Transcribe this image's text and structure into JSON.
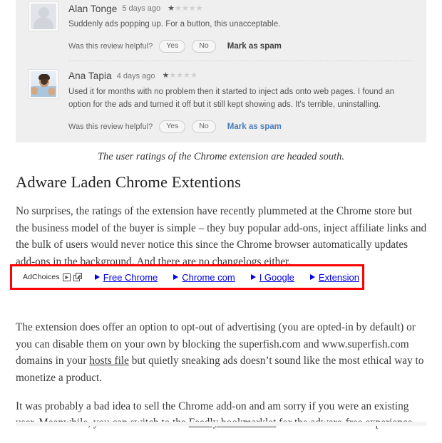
{
  "reviews_panel": {
    "background_color": "#efefef",
    "reviews": [
      {
        "author": "Alan Tonge",
        "age": "5 days ago",
        "rating": 1,
        "rating_max": 5,
        "text": "Suddenly ads popping up. For a button, this unacceptable.",
        "helpful_label": "Was this review helpful?",
        "yes_label": "Yes",
        "no_label": "No",
        "spam_label": "Mark as spam",
        "spam_color": "#3f3f3f",
        "avatar_type": "placeholder-avatar"
      },
      {
        "author": "Ana Tapia",
        "age": "4 days ago",
        "rating": 1,
        "rating_max": 5,
        "text": "Used it for months with no problem then it started to inject ads onto web pages. I found an option for the ads and turned it off but it still kept showing ads. It's terrible, uninstalling.",
        "helpful_label": "Was this review helpful?",
        "yes_label": "Yes",
        "no_label": "No",
        "spam_label": "Mark as spam",
        "spam_color": "#4a7ebb",
        "avatar_type": "user-photo-avatar"
      }
    ]
  },
  "caption": "The user ratings of the Chrome extension are headed south.",
  "article": {
    "heading": "Adware Laden Chrome Extentions",
    "paragraph_1": "No surprises, the ratings of the extension have recently plummeted at the Chrome store but the business model of the buyer is simple – they buy popular add-ons, inject affiliate links and the bulk of users would never notice this since the Chrome browser automatically updates add-ons in the background. And there are no changelogs either.",
    "paragraph_2_a": "The extension does offer an option to opt-out of advertising (you are opted-in by default) or you can disable them on your own by blocking the superfish.com and www.superfish.com domains in your ",
    "paragraph_2_link": "hosts file",
    "paragraph_2_b": " but quietly sneaking ads doesn’t sound like the most ethical way to monetize a product.",
    "paragraph_3_a": "It was probably a bad idea to sell the Chrome add-on and am sorry if you were an existing user. Meanwhile, you can switch to the ",
    "paragraph_3_link": "Feedly bookmarklet",
    "paragraph_3_b": " for the adware-free experience."
  },
  "ad_block": {
    "highlight_color": "#fe0000",
    "adchoices_label": "AdChoices",
    "link_color": "#0000ee",
    "links": [
      {
        "label": "Free Chrome"
      },
      {
        "label": "Chrome com"
      },
      {
        "label": "I Google"
      },
      {
        "label": "Extension"
      }
    ]
  }
}
